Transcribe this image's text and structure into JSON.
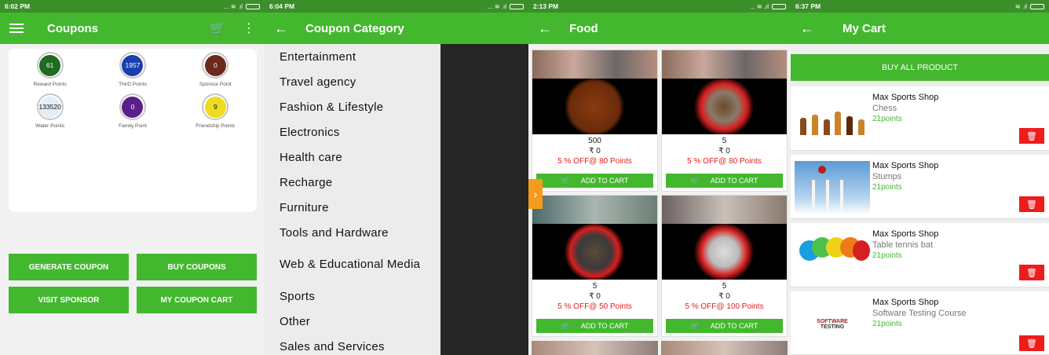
{
  "screen1": {
    "status_time": "6:02 PM",
    "title": "Coupons",
    "points": [
      {
        "value": "61",
        "label": "Reward Points",
        "color": "#1f6b1f"
      },
      {
        "value": "1957",
        "label": "ThirD Points",
        "color": "#1b3fb0"
      },
      {
        "value": "0",
        "label": "Sponsor Point",
        "color": "#6b2a1c"
      },
      {
        "value": "133520",
        "label": "Water Points",
        "color": "#e3eef7"
      },
      {
        "value": "0",
        "label": "Family Point",
        "color": "#5a1f8a"
      },
      {
        "value": "9",
        "label": "Friendship Points",
        "color": "#f0dc1e"
      }
    ],
    "buttons": {
      "generate": "GENERATE COUPON",
      "buy": "BUY COUPONS",
      "visit": "VISIT SPONSOR",
      "cart": "MY COUPON CART"
    }
  },
  "screen2": {
    "status_time": "6:04 PM",
    "title": "Coupon Category",
    "categories": [
      "Entertainment",
      "Travel agency",
      "Fashion & Lifestyle",
      "Electronics",
      "Health care",
      "Recharge",
      "Furniture",
      "Tools and Hardware",
      "Web & Educational Media",
      "Sports",
      "Other",
      "Sales and Services"
    ]
  },
  "screen3": {
    "status_time": "2:13 PM",
    "title": "Food",
    "items": [
      {
        "qty": "500",
        "price": "₹ 0",
        "offer": "5 % OFF@ 80 Points",
        "cart": "ADD TO CART"
      },
      {
        "qty": "5",
        "price": "₹ 0",
        "offer": "5 % OFF@ 80 Points",
        "cart": "ADD TO CART"
      },
      {
        "qty": "5",
        "price": "₹ 0",
        "offer": "5 % OFF@ 50 Points",
        "cart": "ADD TO CART"
      },
      {
        "qty": "5",
        "price": "₹ 0",
        "offer": "5 % OFF@ 100 Points",
        "cart": "ADD TO CART"
      }
    ]
  },
  "screen4": {
    "status_time": "6:37 PM",
    "title": "My Cart",
    "buy_all": "BUY ALL PRODUCT",
    "items": [
      {
        "shop": "Max Sports Shop",
        "name": "Chess",
        "points": "21points"
      },
      {
        "shop": "Max Sports Shop",
        "name": "Stumps",
        "points": "21points"
      },
      {
        "shop": "Max Sports Shop",
        "name": "Table tennis bat",
        "points": "21points"
      },
      {
        "shop": "Max Sports Shop",
        "name": "Software Testing Course",
        "points": "21points"
      }
    ],
    "thumb_text": {
      "line1": "SOFTWARE",
      "line2": "TESTING"
    }
  }
}
